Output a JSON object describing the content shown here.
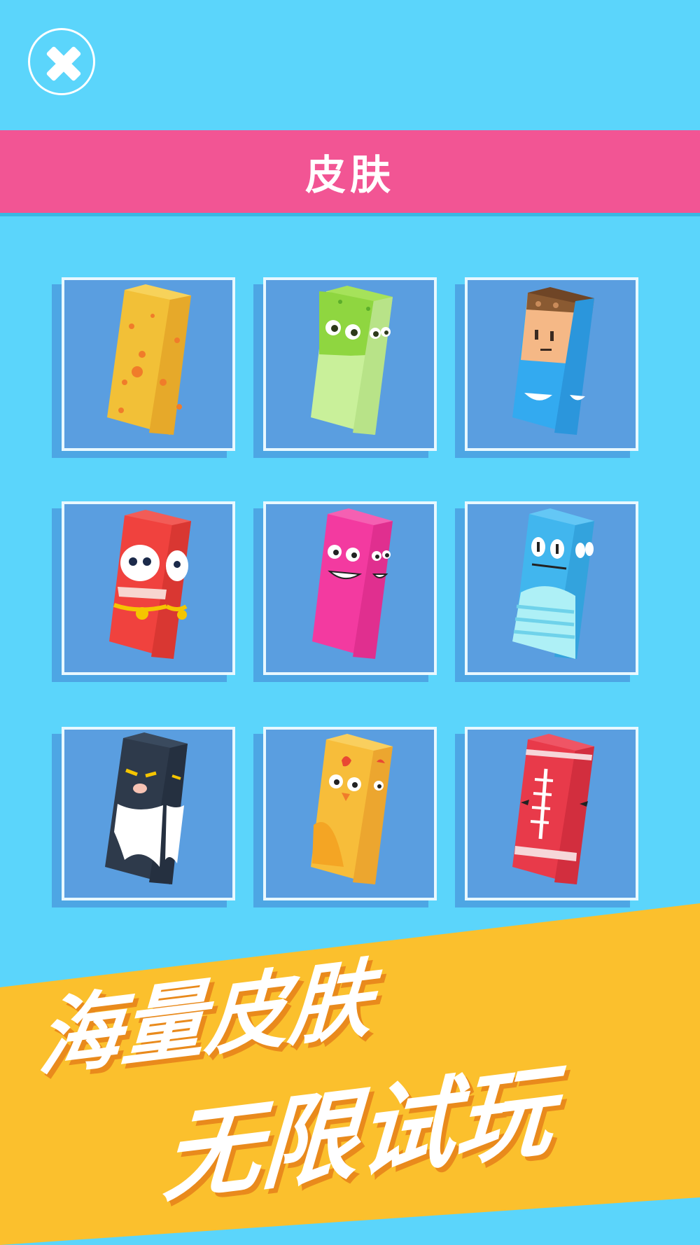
{
  "header": {
    "close_icon": "close-icon",
    "title": "皮肤"
  },
  "skins": [
    {
      "id": "cheese",
      "icon": "cheese-skin-icon",
      "colors": {
        "front": "#f2c037",
        "side": "#e6a92a",
        "top": "#f7d25a"
      }
    },
    {
      "id": "frog",
      "icon": "frog-skin-icon",
      "colors": {
        "front": "#c9f09a",
        "side": "#b8e388",
        "top": "#8fd640"
      }
    },
    {
      "id": "boy",
      "icon": "boy-skin-icon",
      "colors": {
        "front": "#33aaf0",
        "side": "#2b96dc",
        "top": "#8a5a32"
      }
    },
    {
      "id": "daruma",
      "icon": "daruma-skin-icon",
      "colors": {
        "front": "#f0423e",
        "side": "#d93732",
        "top": "#f25c57"
      }
    },
    {
      "id": "pink-monster",
      "icon": "pink-monster-skin-icon",
      "colors": {
        "front": "#f33aa0",
        "side": "#e02f8f",
        "top": "#f560b2"
      }
    },
    {
      "id": "blue-monster",
      "icon": "blue-monster-skin-icon",
      "colors": {
        "front": "#41b6ee",
        "side": "#33a3dd",
        "top": "#64c7f5"
      }
    },
    {
      "id": "cat",
      "icon": "cat-skin-icon",
      "colors": {
        "front": "#2e3a4b",
        "side": "#253040",
        "top": "#3a4a5e"
      }
    },
    {
      "id": "chick",
      "icon": "chick-skin-icon",
      "colors": {
        "front": "#f7bd3a",
        "side": "#eca62f",
        "top": "#f9cf5e"
      }
    },
    {
      "id": "football",
      "icon": "football-skin-icon",
      "colors": {
        "front": "#e83a4a",
        "side": "#d22e3e",
        "top": "#ef5565"
      }
    }
  ],
  "promo": {
    "line1": "海量皮肤",
    "line2": "无限试玩",
    "banner_color": "#fbc02d"
  }
}
